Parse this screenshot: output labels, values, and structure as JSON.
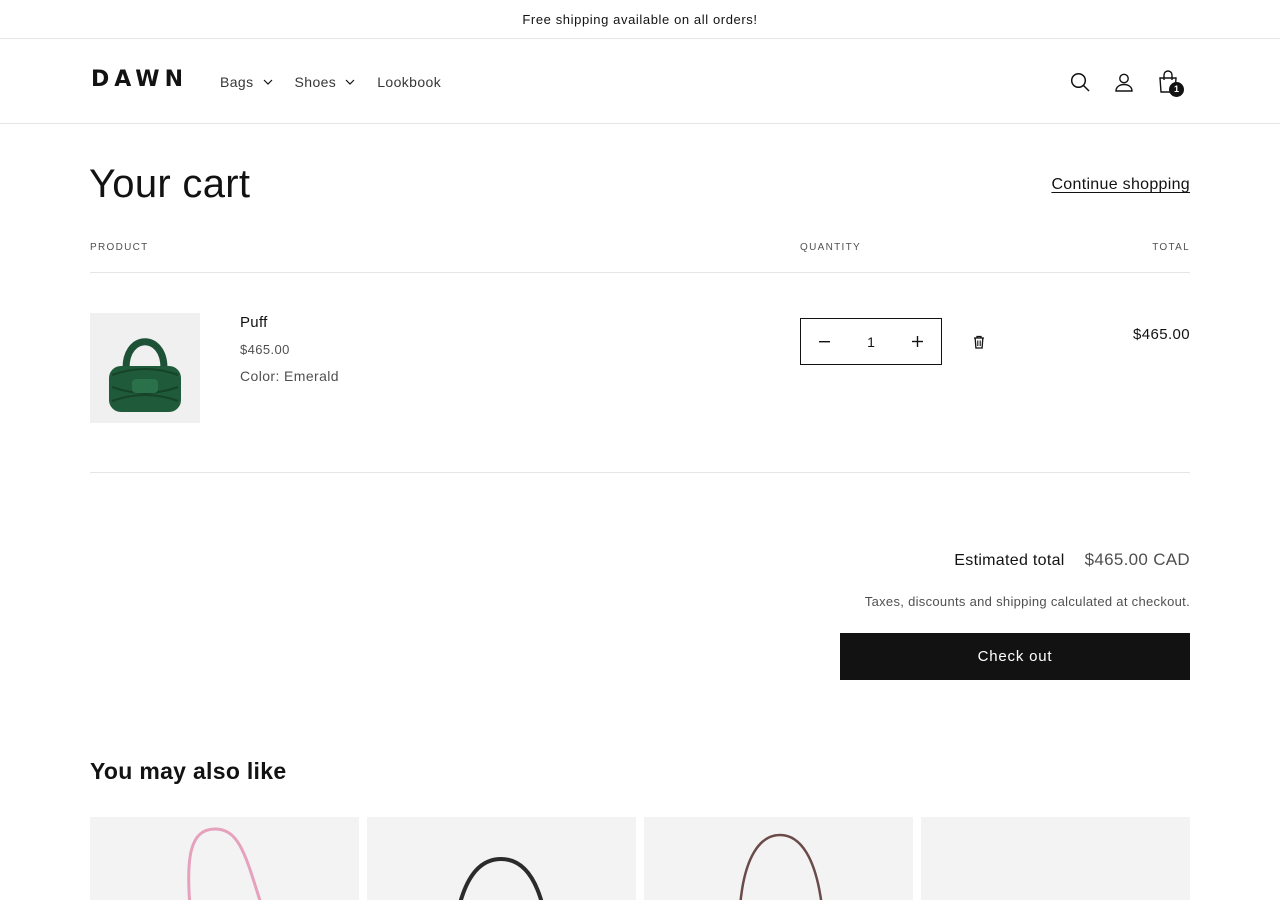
{
  "announcement": {
    "text": "Free shipping available on all orders!"
  },
  "header": {
    "logo": "DAWN",
    "nav": [
      {
        "label": "Bags",
        "has_dropdown": true
      },
      {
        "label": "Shoes",
        "has_dropdown": true
      },
      {
        "label": "Lookbook",
        "has_dropdown": false
      }
    ],
    "icons": [
      "search-icon",
      "account-icon",
      "cart-icon"
    ],
    "cart_count": "1"
  },
  "cart": {
    "title": "Your cart",
    "continue_label": "Continue shopping",
    "columns": {
      "product": "PRODUCT",
      "quantity": "QUANTITY",
      "total": "TOTAL"
    },
    "items": [
      {
        "name": "Puff",
        "price": "$465.00",
        "option": "Color: Emerald",
        "quantity": "1",
        "line_total": "$465.00",
        "image_color": "#1f5a3a"
      }
    ]
  },
  "summary": {
    "estimated_label": "Estimated total",
    "estimated_value": "$465.00 CAD",
    "tax_note": "Taxes, discounts and shipping calculated at checkout.",
    "checkout_label": "Check out"
  },
  "recommendations": {
    "title": "You may also like",
    "cards": [
      {
        "strap_color": "#e6a1bd"
      },
      {
        "strap_color": "#2b2b2b"
      },
      {
        "strap_color": "#6b4a4a"
      },
      {
        "strap_color": ""
      }
    ]
  },
  "colors": {
    "text": "#121212",
    "button_bg": "#121212",
    "border": "#e6e6e6",
    "image_bg": "#f3f3f3"
  }
}
